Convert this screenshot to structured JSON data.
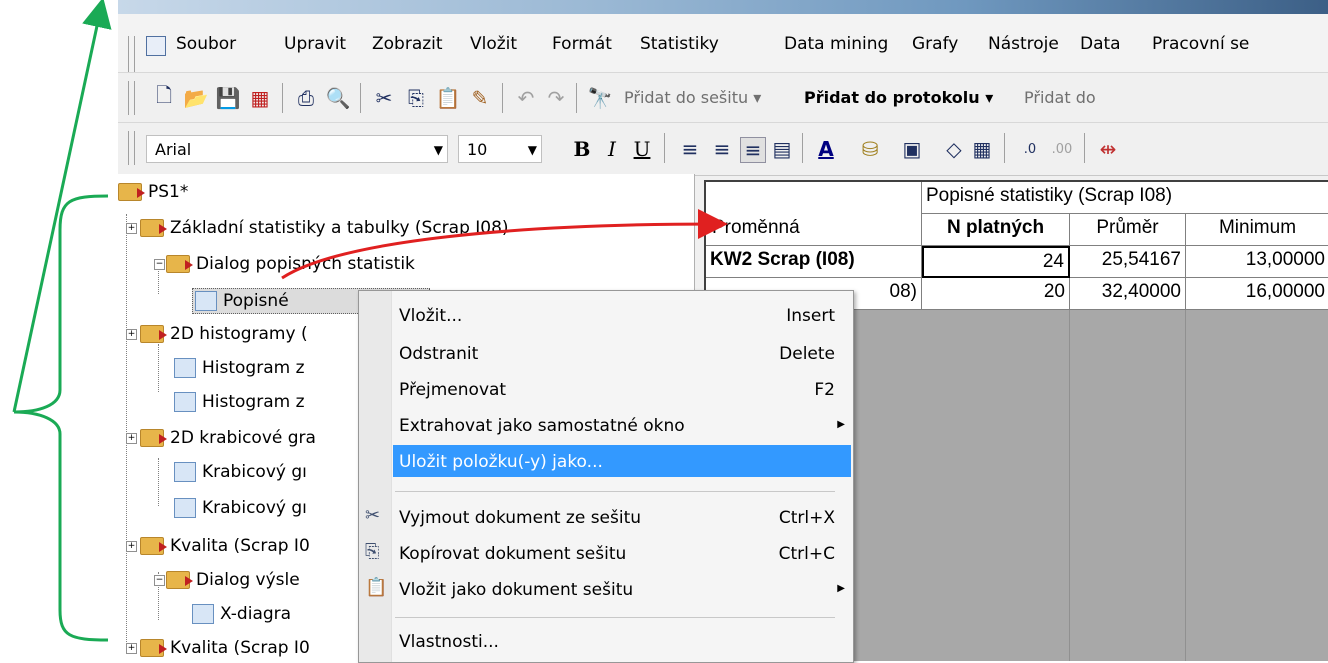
{
  "menu": {
    "items": [
      "Soubor",
      "Upravit",
      "Zobrazit",
      "Vložit",
      "Formát",
      "Statistiky",
      "Data mining",
      "Grafy",
      "Nástroje",
      "Data",
      "Pracovní se"
    ]
  },
  "toolbar": {
    "add_to_workbook": "Přidat do sešitu ▾",
    "add_to_report": "Přidat do protokolu ▾",
    "add_to_other": "Přidat do",
    "font_name": "Arial",
    "font_size": "10"
  },
  "tree": {
    "root": "PS1*",
    "nodes": [
      {
        "label": "Základní statistiky a tabulky (Scrap I08)"
      },
      {
        "label": "Dialog popisných statistik"
      },
      {
        "label": "Popisné"
      },
      {
        "label": "2D histogramy ("
      },
      {
        "label": "Histogram z"
      },
      {
        "label": "Histogram z"
      },
      {
        "label": "2D krabicové gra"
      },
      {
        "label": "Krabicový gı"
      },
      {
        "label": "Krabicový gı"
      },
      {
        "label": "Kvalita (Scrap I0"
      },
      {
        "label": "Dialog výsle"
      },
      {
        "label": "X-diagra"
      },
      {
        "label": "Kvalita (Scrap I0"
      }
    ]
  },
  "spreadsheet": {
    "title": "Popisné statistiky (Scrap I08)",
    "row_header_label": "Proměnná",
    "columns": [
      "N platných",
      "Průměr",
      "Minimum"
    ],
    "rows": [
      {
        "name": "KW2 Scrap (I08)",
        "values": [
          "24",
          "25,54167",
          "13,00000"
        ]
      },
      {
        "name": "08)",
        "values": [
          "20",
          "32,40000",
          "16,00000"
        ]
      }
    ]
  },
  "context_menu": {
    "items": [
      {
        "label": "Vložit...",
        "shortcut": "Insert"
      },
      {
        "label": "Odstranit",
        "shortcut": "Delete"
      },
      {
        "label": "Přejmenovat",
        "shortcut": "F2"
      },
      {
        "label": "Extrahovat jako samostatné okno",
        "shortcut": ""
      },
      {
        "label": "Uložit položku(-y) jako...",
        "shortcut": ""
      },
      {
        "label": "Vyjmout dokument ze sešitu",
        "shortcut": "Ctrl+X"
      },
      {
        "label": "Kopírovat dokument sešitu",
        "shortcut": "Ctrl+C"
      },
      {
        "label": "Vložit jako dokument sešitu",
        "shortcut": ""
      },
      {
        "label": "Vlastnosti...",
        "shortcut": ""
      }
    ]
  },
  "colors": {
    "annotation_green": "#1aaa55",
    "annotation_red": "#e02020",
    "highlight_blue": "#3399ff"
  }
}
